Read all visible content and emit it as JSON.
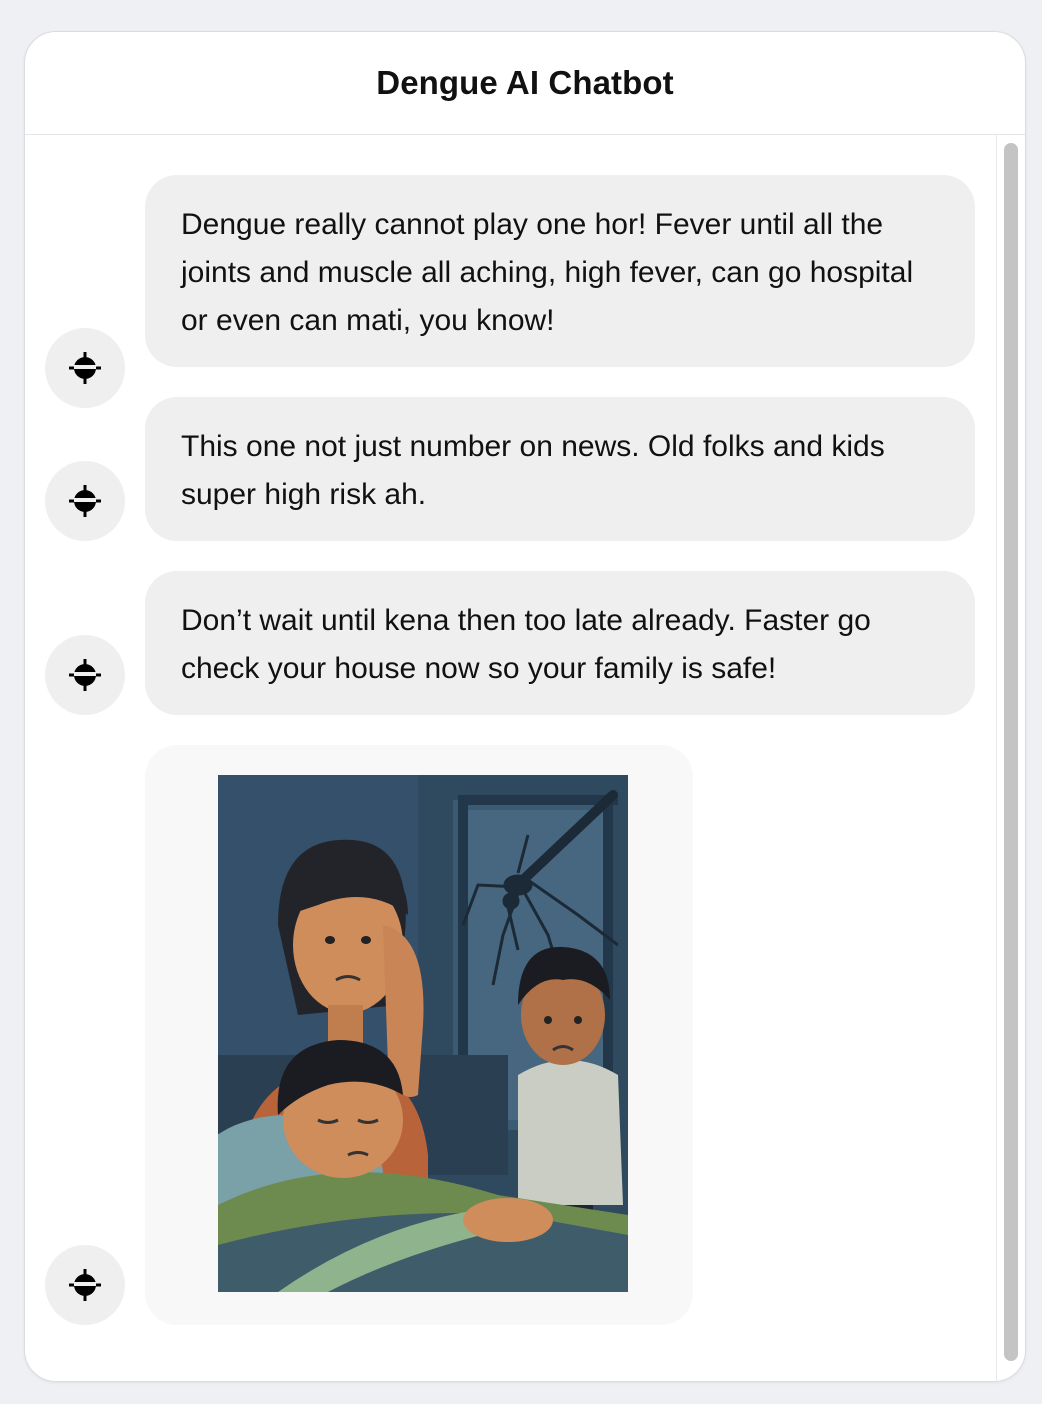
{
  "header": {
    "title": "Dengue AI Chatbot"
  },
  "messages": [
    {
      "text": "Dengue really cannot play one hor! Fever until all the joints and muscle all aching, high fever, can go hospital or even can mati, you know!"
    },
    {
      "text": "This one not just number on news. Old folks and kids super high risk ah."
    },
    {
      "text": "Don’t wait until kena then too late already. Faster go check your house now so your family is safe!"
    }
  ],
  "avatar_icon": "bot-target-icon",
  "colors": {
    "bubble_bg": "#efefef",
    "image_bubble_bg": "#f8f8f8",
    "page_bg": "#eef0f4",
    "scrollbar_thumb": "#c4c4c4"
  }
}
